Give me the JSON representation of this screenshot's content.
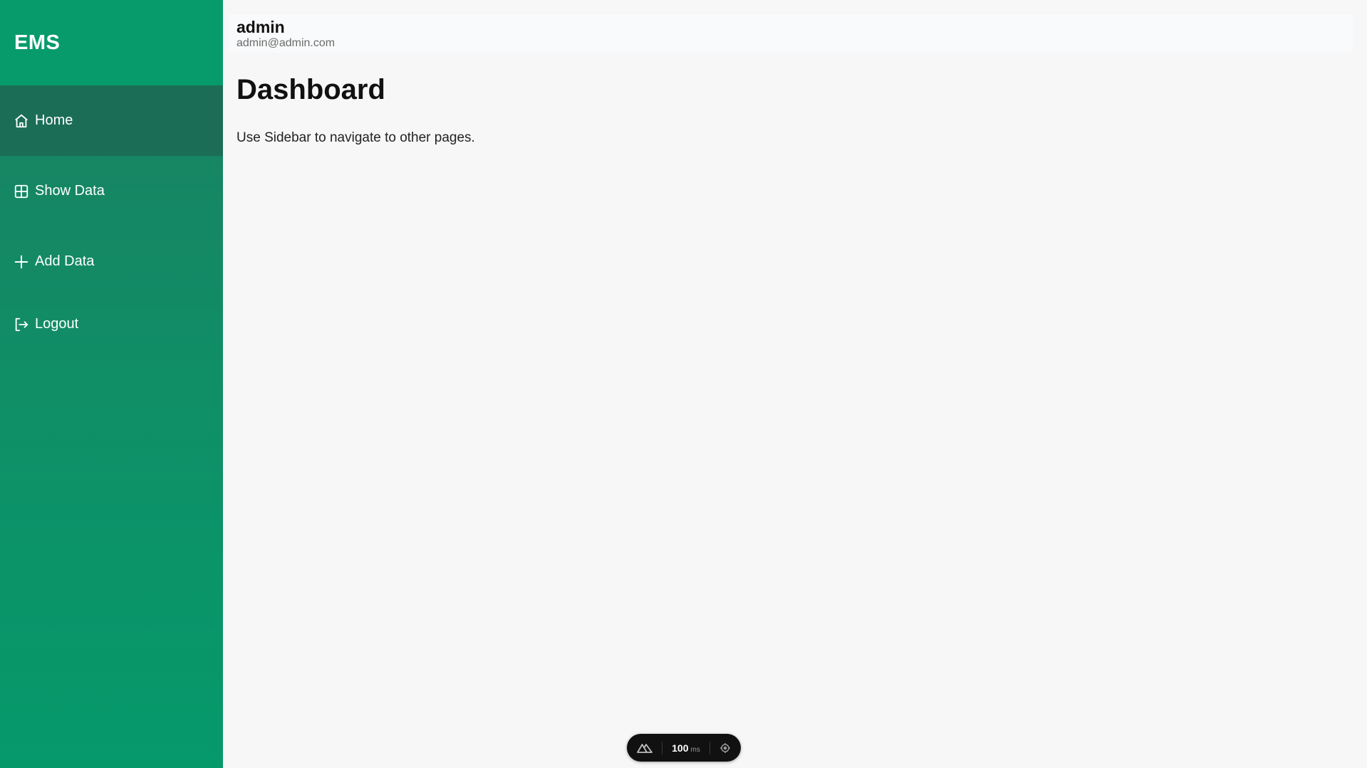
{
  "sidebar": {
    "brand": "EMS",
    "items": [
      {
        "label": "Home",
        "icon": "home-icon",
        "active": true
      },
      {
        "label": "Show Data",
        "icon": "table-icon",
        "active": false
      },
      {
        "label": "Add Data",
        "icon": "plus-icon",
        "active": false
      },
      {
        "label": "Logout",
        "icon": "logout-icon",
        "active": false
      }
    ]
  },
  "header": {
    "user_name": "admin",
    "user_email": "admin@admin.com"
  },
  "main": {
    "title": "Dashboard",
    "text": "Use Sidebar to navigate to other pages."
  },
  "dev_widget": {
    "time_value": "100",
    "time_unit": "ms"
  },
  "colors": {
    "sidebar_top": "#079b6b",
    "sidebar_active": "#1b6e55",
    "background": "#f7f7f7"
  }
}
